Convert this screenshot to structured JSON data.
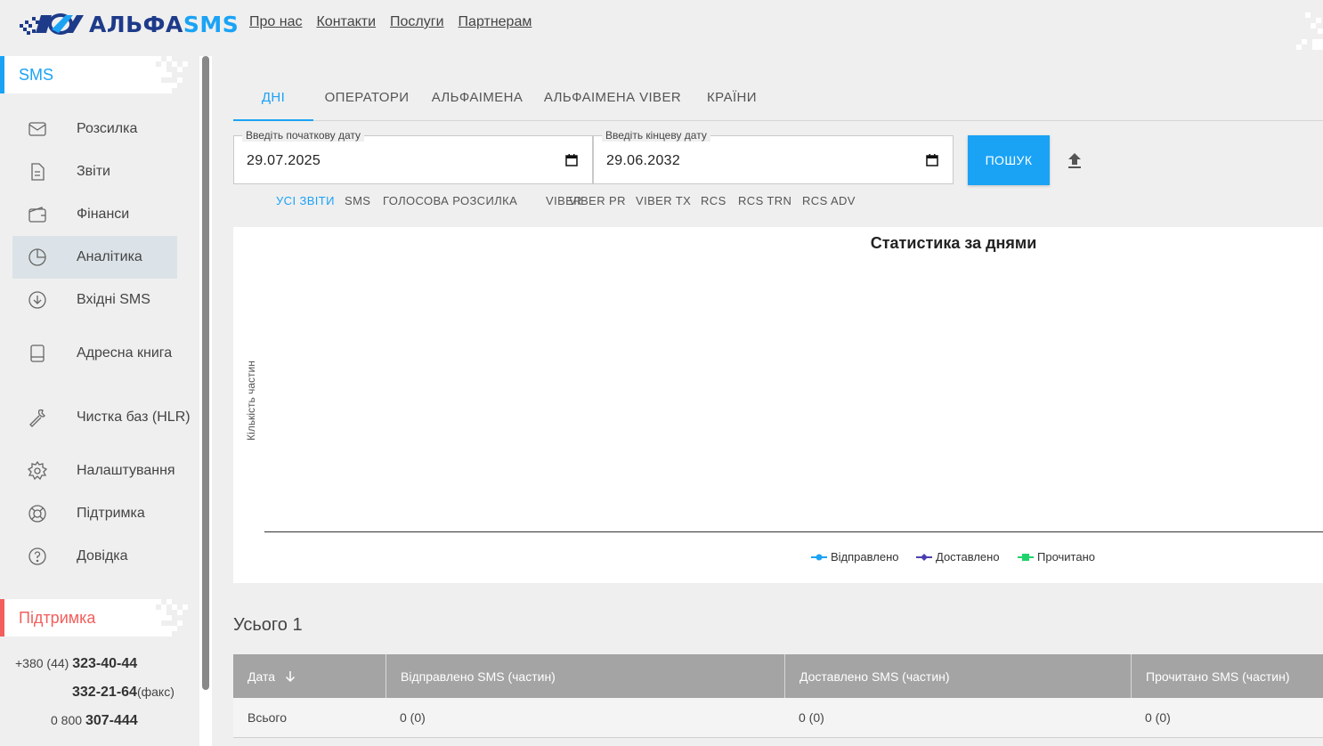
{
  "logo": {
    "part1": "АЛЬФА",
    "part2": "SMS"
  },
  "topnav": [
    "Про нас",
    "Контакти",
    "Послуги",
    "Партнерам"
  ],
  "sidebar": {
    "section_sms": "SMS",
    "accent_blue": "#1aa3f5",
    "items": [
      {
        "label": "Розсилка",
        "icon": "envelope-icon"
      },
      {
        "label": "Звіти",
        "icon": "document-icon"
      },
      {
        "label": "Фінанси",
        "icon": "wallet-icon"
      },
      {
        "label": "Аналітика",
        "icon": "pie-chart-icon",
        "active": true
      },
      {
        "label": "Вхідні SMS",
        "icon": "download-circle-icon"
      },
      {
        "label": "Адресна книга",
        "icon": "book-icon"
      },
      {
        "label": "Чистка баз (HLR)",
        "icon": "wrench-icon"
      },
      {
        "label": "Налаштування",
        "icon": "gear-icon"
      },
      {
        "label": "Підтримка",
        "icon": "lifebuoy-icon"
      },
      {
        "label": "Довідка",
        "icon": "help-circle-icon"
      }
    ],
    "section_support": "Підтримка",
    "accent_red": "#f25f5c",
    "phones": {
      "prefix1": "+380 (44)",
      "num1": "323-40-44",
      "num2": "332-21-64",
      "suffix2": "(факс)",
      "prefix3": "0 800",
      "num3": "307-444"
    }
  },
  "tabs": [
    "ДНІ",
    "ОПЕРАТОРИ",
    "АЛЬФАІМЕНА",
    "АЛЬФАІМЕНА VIBER",
    "КРАЇНИ"
  ],
  "date_start": {
    "label": "Введіть початкову дату",
    "value": "29.07.2025"
  },
  "date_end": {
    "label": "Введіть кінцеву дату",
    "value": "29.06.2032"
  },
  "search_label": "ПОШУК",
  "filters": [
    "УСІ ЗВІТИ",
    "SMS",
    "ГОЛОСОВА РОЗСИЛКА",
    "VIBER",
    "VIBER PR",
    "VIBER TX",
    "RCS",
    "RCS TRN",
    "RCS ADV"
  ],
  "chart_data": {
    "type": "line",
    "title": "Статистика за днями",
    "ylabel": "Кількість частин",
    "xlabel": "",
    "series": [
      {
        "name": "Відправлено",
        "color": "#1aa3f5",
        "values": []
      },
      {
        "name": "Доставлено",
        "color": "#4b3fb0",
        "values": []
      },
      {
        "name": "Прочитано",
        "color": "#1fd36b",
        "values": []
      }
    ],
    "legend_position": "bottom-center"
  },
  "total_label": "Усього 1",
  "table": {
    "headers": [
      "Дата",
      "Відправлено SMS (частин)",
      "Доставлено SMS (частин)",
      "Прочитано SMS (частин)"
    ],
    "sort_icon": "arrow-down-icon",
    "rows": [
      [
        "Всього",
        "0 (0)",
        "0 (0)",
        "0 (0)"
      ]
    ]
  }
}
